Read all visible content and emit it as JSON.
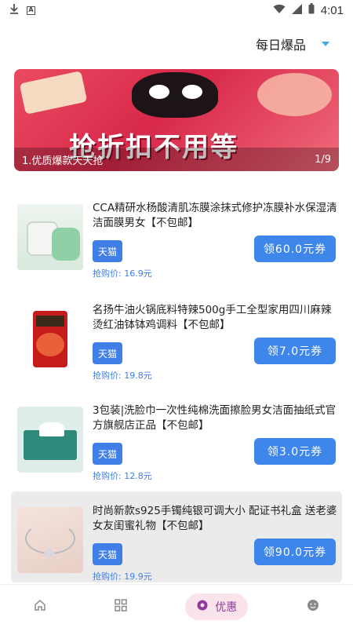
{
  "status_bar": {
    "time": "4:01",
    "left_icons": [
      "download-icon",
      "app-a-icon"
    ],
    "right_icons": [
      "wifi-icon",
      "signal-icon",
      "battery-icon"
    ],
    "box_glyph": "A"
  },
  "filter": {
    "label": "每日爆品",
    "caret_color": "#3ea9e8"
  },
  "banner": {
    "headline": "抢折扣不用等",
    "caption": "1.优质爆款天天抢",
    "pager": "1/9"
  },
  "products": [
    {
      "title": "CCA精研水杨酸清肌冻膜涂抹式修护冻膜补水保湿清洁面膜男女【不包邮】",
      "shop": "天猫",
      "price_label": "抢购价: 16.9元",
      "coupon": "领60.0元券",
      "thumb": "face-mask-jar"
    },
    {
      "title": "名扬牛油火锅底料特辣500g手工全型家用四川麻辣烫红油钵钵鸡调料【不包邮】",
      "shop": "天猫",
      "price_label": "抢购价: 19.8元",
      "coupon": "领7.0元券",
      "thumb": "hotpot-seasoning-bag"
    },
    {
      "title": "3包装|洗脸巾一次性纯棉洗面擦脸男女洁面抽纸式官方旗舰店正品【不包邮】",
      "shop": "天猫",
      "price_label": "抢购价: 12.8元",
      "coupon": "领3.0元券",
      "thumb": "face-towel-box"
    },
    {
      "title": "时尚新款s925手镯纯银可调大小 配证书礼盒 送老婆女友闺蜜礼物【不包邮】",
      "shop": "天猫",
      "price_label": "抢购价: 19.9元",
      "coupon": "领90.0元券",
      "thumb": "silver-bracelet"
    }
  ],
  "bottom_nav": {
    "items": [
      {
        "icon": "home-icon",
        "label": ""
      },
      {
        "icon": "grid-icon",
        "label": ""
      },
      {
        "icon": "discount-icon",
        "label": "优惠",
        "active": true
      },
      {
        "icon": "profile-icon",
        "label": ""
      }
    ]
  },
  "colors": {
    "accent_blue": "#3f86ea",
    "active_nav_bg": "#fbe3ec",
    "active_nav_fg": "#8e3c9c"
  }
}
